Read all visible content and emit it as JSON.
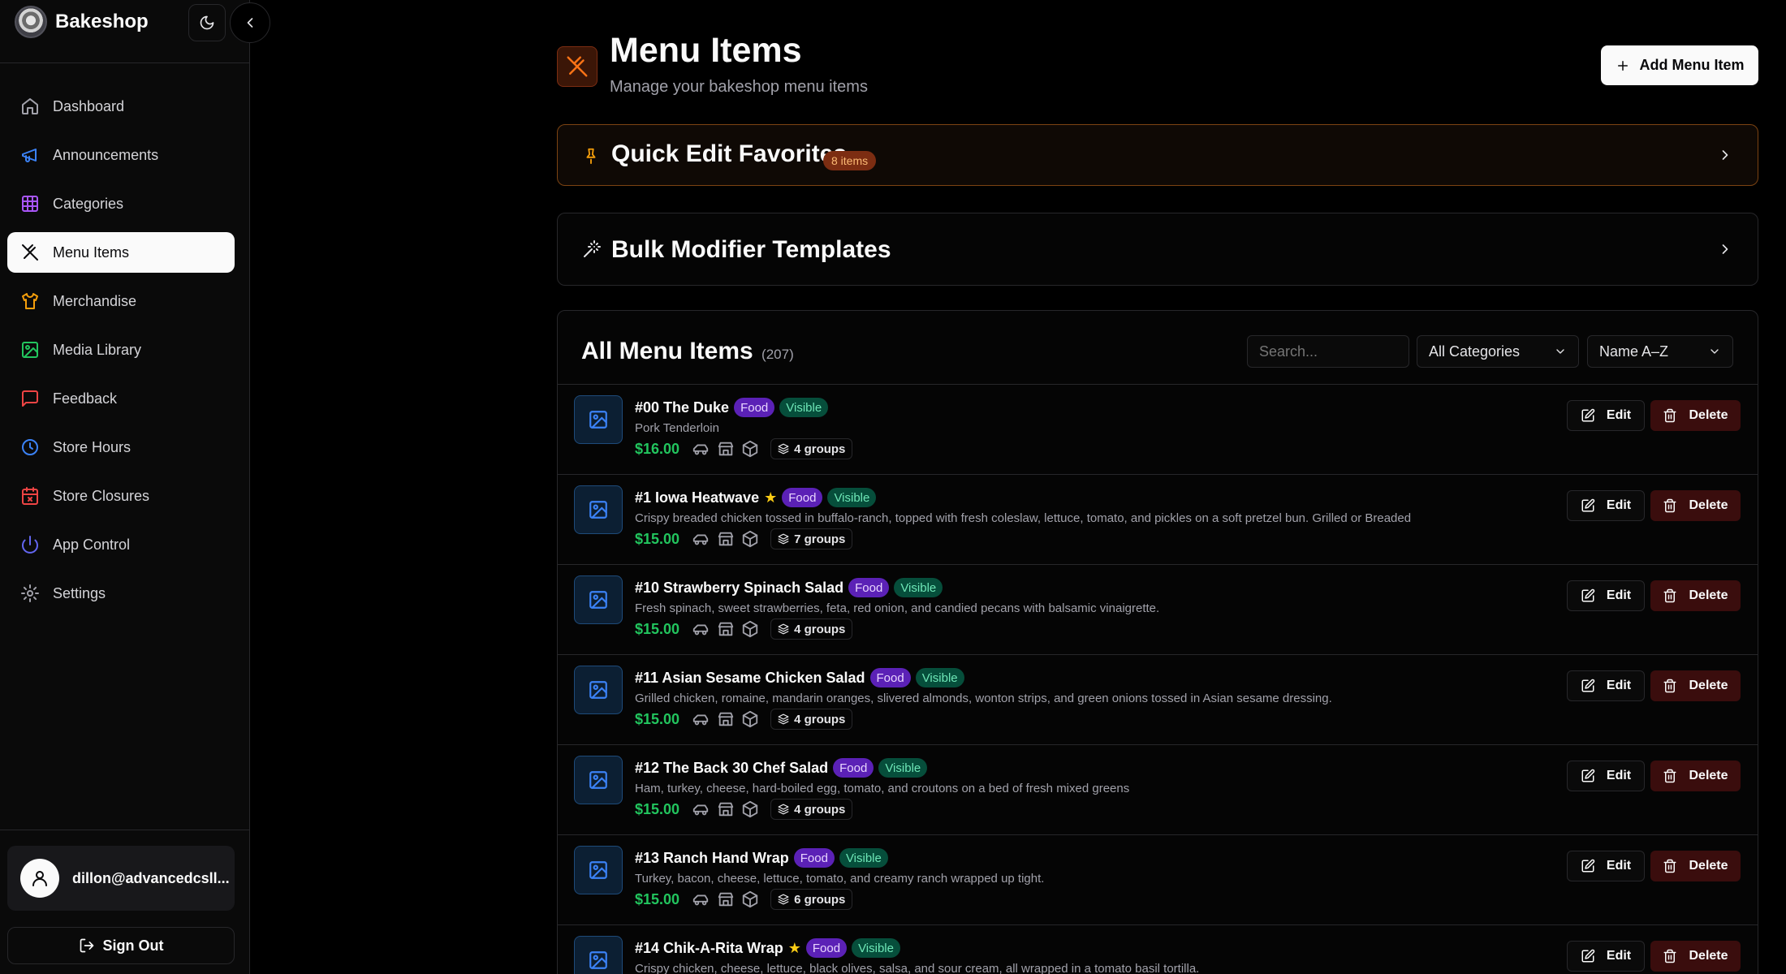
{
  "brand": {
    "name": "Bakeshop"
  },
  "sidebar": {
    "items": [
      {
        "label": "Dashboard",
        "icon": "home-icon",
        "color": "#a1a1aa",
        "active": false
      },
      {
        "label": "Announcements",
        "icon": "megaphone-icon",
        "color": "#3b82f6",
        "active": false
      },
      {
        "label": "Categories",
        "icon": "grid-icon",
        "color": "#a855f7",
        "active": false
      },
      {
        "label": "Menu Items",
        "icon": "utensils-icon",
        "color": "#09090b",
        "active": true
      },
      {
        "label": "Merchandise",
        "icon": "shirt-icon",
        "color": "#f59e0b",
        "active": false
      },
      {
        "label": "Media Library",
        "icon": "image-icon",
        "color": "#22c55e",
        "active": false
      },
      {
        "label": "Feedback",
        "icon": "message-icon",
        "color": "#ef4444",
        "active": false
      },
      {
        "label": "Store Hours",
        "icon": "clock-icon",
        "color": "#3b82f6",
        "active": false
      },
      {
        "label": "Store Closures",
        "icon": "calendar-x-icon",
        "color": "#ef4444",
        "active": false
      },
      {
        "label": "App Control",
        "icon": "power-icon",
        "color": "#6366f1",
        "active": false
      },
      {
        "label": "Settings",
        "icon": "gear-icon",
        "color": "#a1a1aa",
        "active": false
      }
    ],
    "user_email": "dillon@advancedcsll...",
    "sign_out_label": "Sign Out"
  },
  "header": {
    "title": "Menu Items",
    "subtitle": "Manage your bakeshop menu items",
    "add_label": "Add Menu Item"
  },
  "favorites": {
    "title": "Quick Edit Favorites",
    "badge": "8 items"
  },
  "bulk": {
    "title": "Bulk Modifier Templates"
  },
  "list": {
    "title": "All Menu Items",
    "count": "(207)",
    "search_placeholder": "Search...",
    "category_filter": "All Categories",
    "sort": "Name A–Z",
    "edit_label": "Edit",
    "delete_label": "Delete",
    "items": [
      {
        "name": "#00 The Duke",
        "starred": false,
        "category": "Food",
        "visibility": "Visible",
        "description": "Pork Tenderloin",
        "price": "$16.00",
        "groups": "4 groups"
      },
      {
        "name": "#1 Iowa Heatwave",
        "starred": true,
        "category": "Food",
        "visibility": "Visible",
        "description": "Crispy breaded chicken tossed in buffalo-ranch, topped with fresh coleslaw, lettuce, tomato, and pickles on a soft pretzel bun. Grilled or Breaded",
        "price": "$15.00",
        "groups": "7 groups"
      },
      {
        "name": "#10 Strawberry Spinach Salad",
        "starred": false,
        "category": "Food",
        "visibility": "Visible",
        "description": "Fresh spinach, sweet strawberries, feta, red onion, and candied pecans with balsamic vinaigrette.",
        "price": "$15.00",
        "groups": "4 groups"
      },
      {
        "name": "#11 Asian Sesame Chicken Salad",
        "starred": false,
        "category": "Food",
        "visibility": "Visible",
        "description": "Grilled chicken, romaine, mandarin oranges, slivered almonds, wonton strips, and green onions tossed in Asian sesame dressing.",
        "price": "$15.00",
        "groups": "4 groups"
      },
      {
        "name": "#12 The Back 30 Chef Salad",
        "starred": false,
        "category": "Food",
        "visibility": "Visible",
        "description": "Ham, turkey, cheese, hard-boiled egg, tomato, and croutons on a bed of fresh mixed greens",
        "price": "$15.00",
        "groups": "4 groups"
      },
      {
        "name": "#13 Ranch Hand Wrap",
        "starred": false,
        "category": "Food",
        "visibility": "Visible",
        "description": "Turkey, bacon, cheese, lettuce, tomato, and creamy ranch wrapped up tight.",
        "price": "$15.00",
        "groups": "6 groups"
      },
      {
        "name": "#14 Chik-A-Rita Wrap",
        "starred": true,
        "category": "Food",
        "visibility": "Visible",
        "description": "Crispy chicken, cheese, lettuce, black olives, salsa, and sour cream, all wrapped in a tomato basil tortilla.",
        "price": "",
        "groups": ""
      }
    ]
  }
}
